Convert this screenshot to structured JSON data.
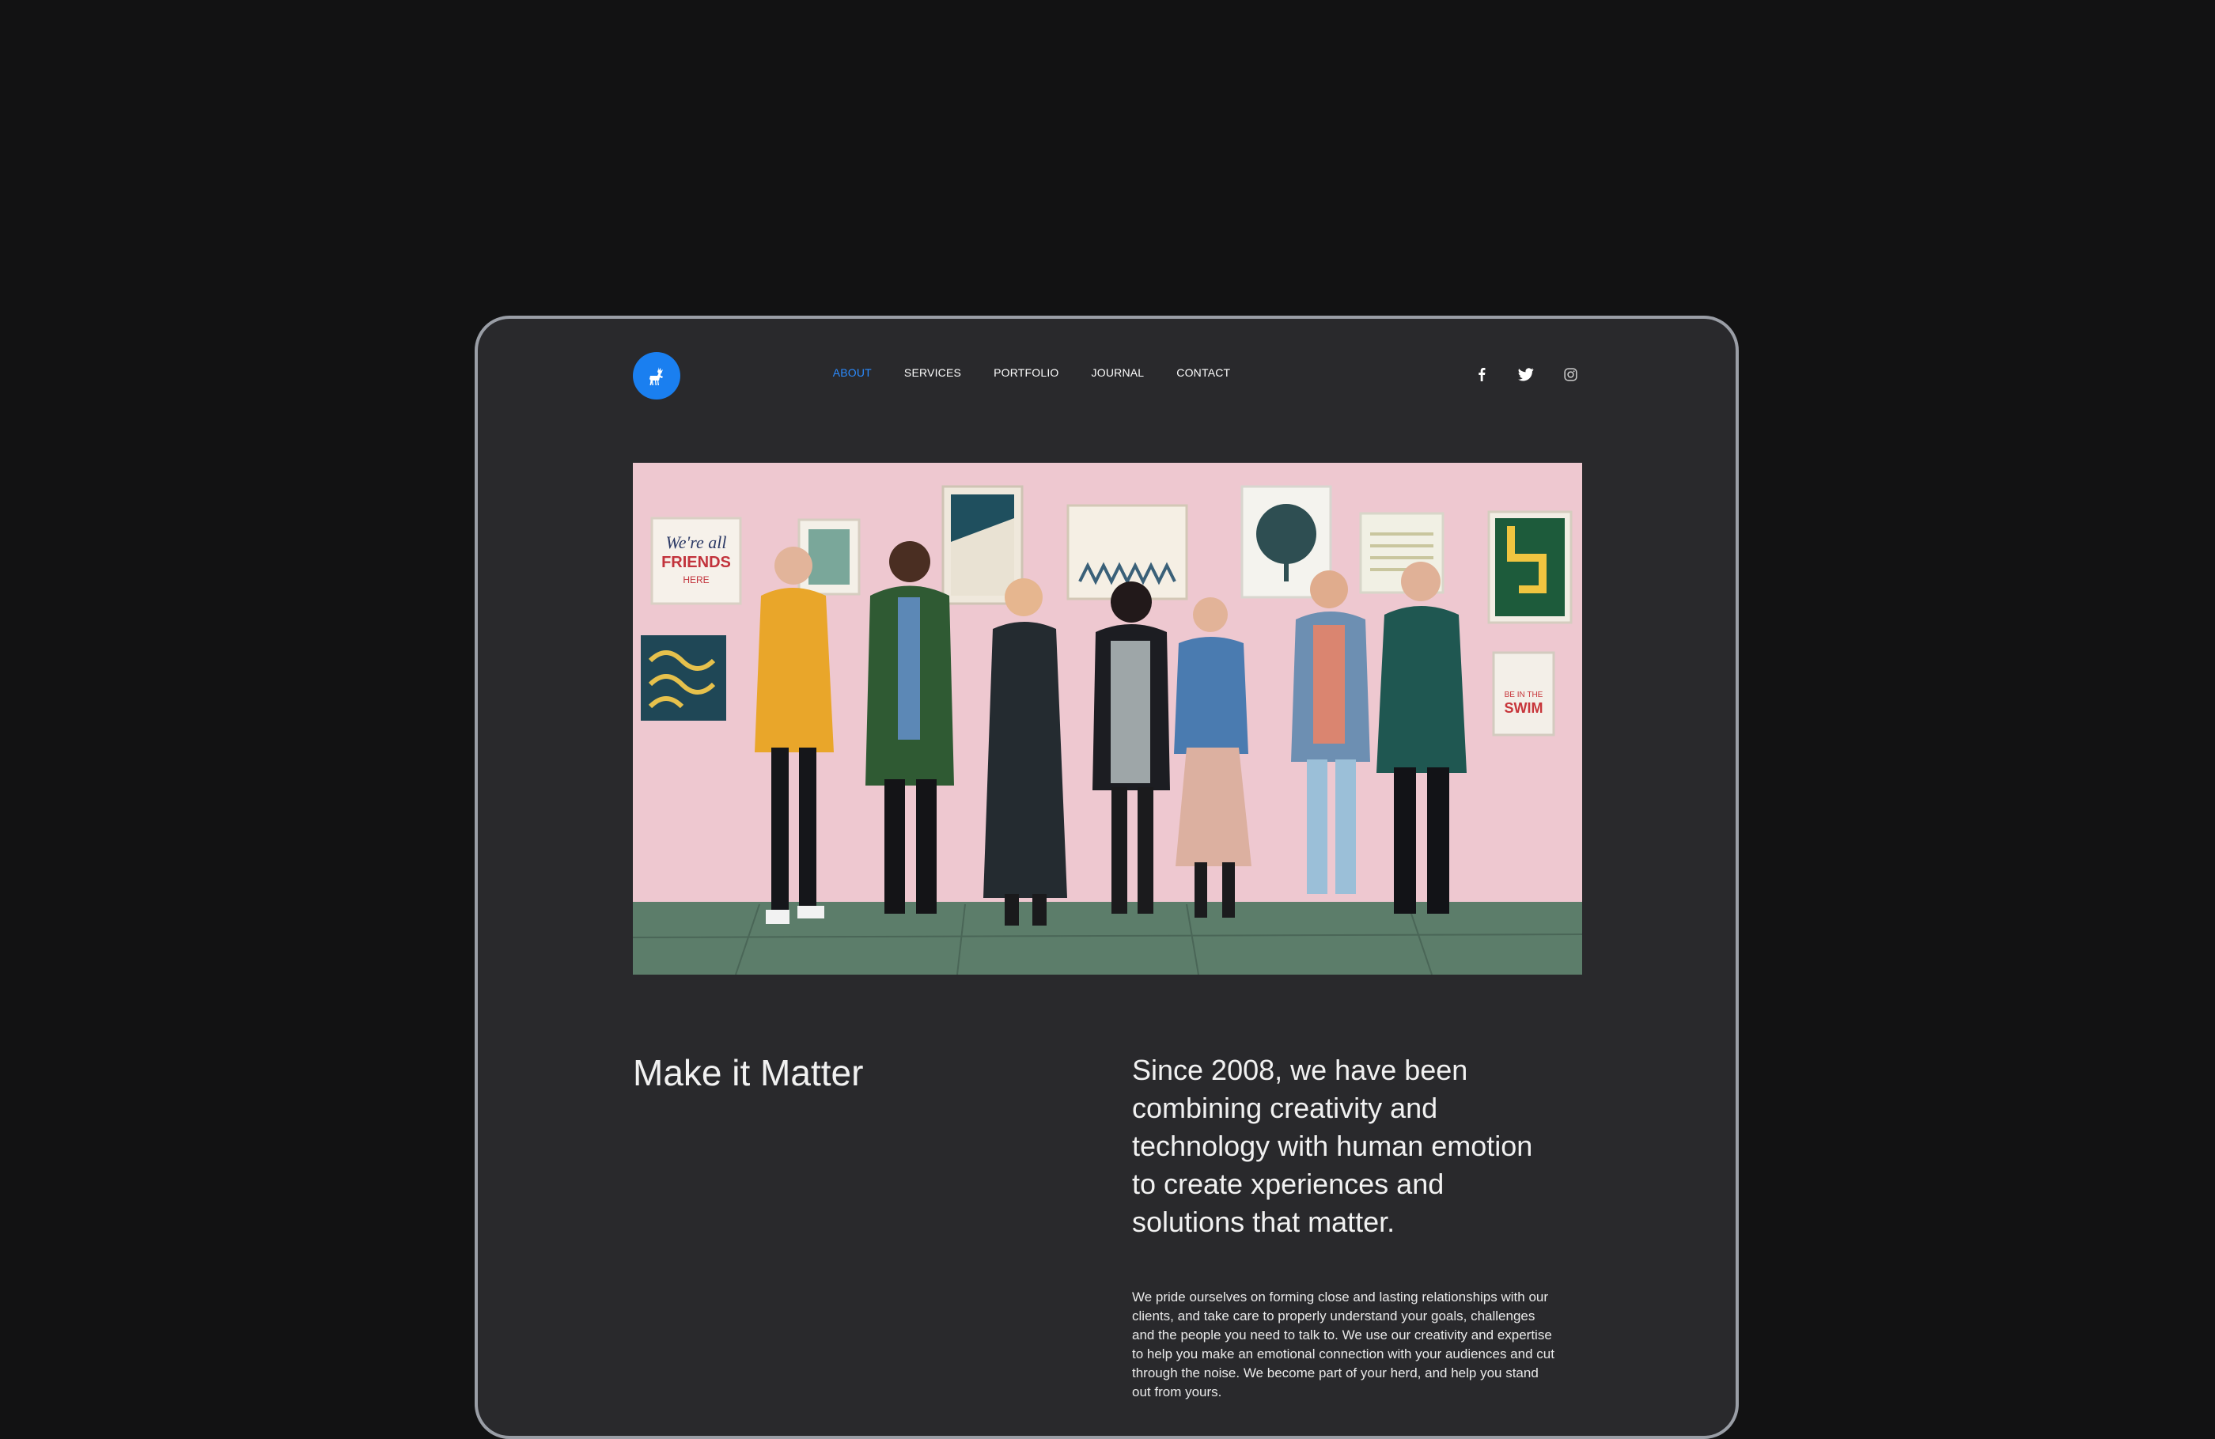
{
  "brand": {
    "logo_icon": "deer-icon",
    "accent": "#1a7ff0"
  },
  "nav": {
    "items": [
      {
        "label": "ABOUT",
        "active": true
      },
      {
        "label": "SERVICES",
        "active": false
      },
      {
        "label": "PORTFOLIO",
        "active": false
      },
      {
        "label": "JOURNAL",
        "active": false
      },
      {
        "label": "CONTACT",
        "active": false
      }
    ]
  },
  "social": [
    "facebook-icon",
    "twitter-icon",
    "instagram-icon"
  ],
  "hero": {
    "image": "team-photo",
    "posters": {
      "friends": [
        "We're all",
        "FRIENDS",
        "HERE"
      ],
      "swim": [
        "BE IN THE",
        "SWIM"
      ]
    }
  },
  "content": {
    "headline": "Make it Matter",
    "lead": "Since 2008, we have been combining creativity and technology with human emotion to create xperiences and solutions that matter.",
    "body": "We pride ourselves on forming close and lasting relationships with our clients, and take care to properly understand your goals, challenges and the people you need to talk to. We use our creativity and expertise to help you make an emotional connection with your audiences and cut through the noise. We become part of your herd, and help you stand out from yours."
  },
  "colors": {
    "page_bg": "#121213",
    "device_bg": "#29292c",
    "nav_active": "#2a8bff",
    "hero_wall": "#efc9d1"
  }
}
